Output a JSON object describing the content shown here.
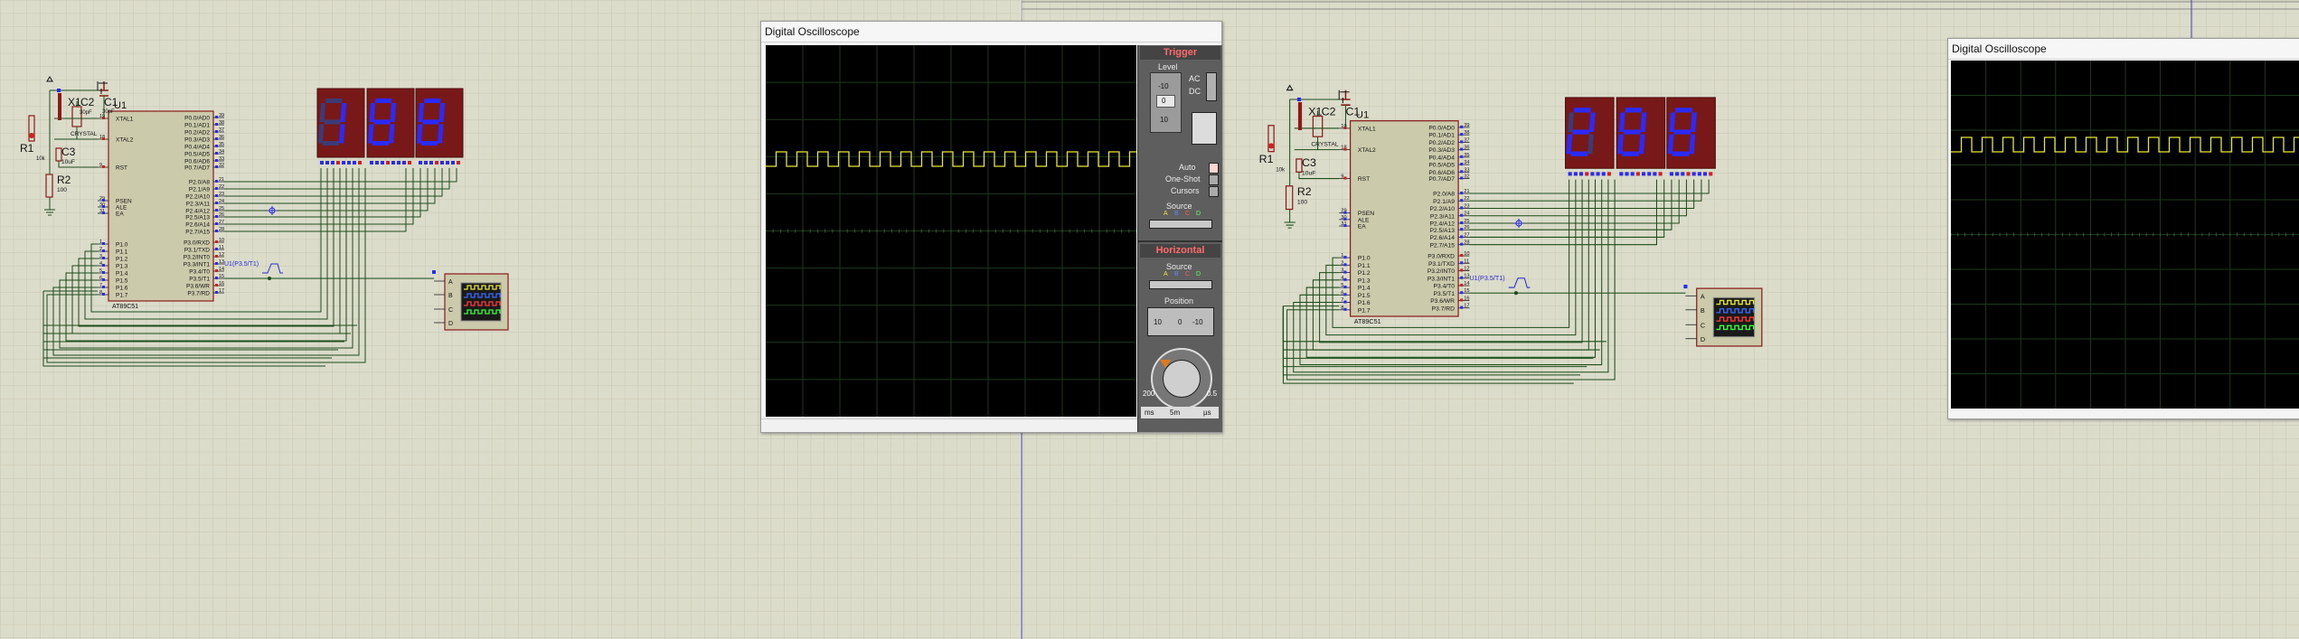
{
  "left_circuit": {
    "mcu_label": "U1",
    "mcu_part": "AT89C51",
    "left_pins": [
      {
        "num": "19",
        "name": "XTAL1"
      },
      {
        "num": "18",
        "name": "XTAL2"
      },
      {
        "num": "9",
        "name": "RST"
      },
      {
        "num": "29",
        "name": "PSEN"
      },
      {
        "num": "30",
        "name": "ALE"
      },
      {
        "num": "31",
        "name": "EA"
      },
      {
        "num": "1",
        "name": "P1.0"
      },
      {
        "num": "2",
        "name": "P1.1"
      },
      {
        "num": "3",
        "name": "P1.2"
      },
      {
        "num": "4",
        "name": "P1.3"
      },
      {
        "num": "5",
        "name": "P1.4"
      },
      {
        "num": "6",
        "name": "P1.5"
      },
      {
        "num": "7",
        "name": "P1.6"
      },
      {
        "num": "8",
        "name": "P1.7"
      }
    ],
    "right_pins": [
      {
        "num": "39",
        "name": "P0.0/AD0"
      },
      {
        "num": "38",
        "name": "P0.1/AD1"
      },
      {
        "num": "37",
        "name": "P0.2/AD2"
      },
      {
        "num": "36",
        "name": "P0.3/AD3"
      },
      {
        "num": "35",
        "name": "P0.4/AD4"
      },
      {
        "num": "34",
        "name": "P0.5/AD5"
      },
      {
        "num": "33",
        "name": "P0.6/AD6"
      },
      {
        "num": "32",
        "name": "P0.7/AD7"
      },
      {
        "num": "21",
        "name": "P2.0/A8"
      },
      {
        "num": "22",
        "name": "P2.1/A9"
      },
      {
        "num": "23",
        "name": "P2.2/A10"
      },
      {
        "num": "24",
        "name": "P2.3/A11"
      },
      {
        "num": "25",
        "name": "P2.4/A12"
      },
      {
        "num": "26",
        "name": "P2.5/A13"
      },
      {
        "num": "27",
        "name": "P2.6/A14"
      },
      {
        "num": "28",
        "name": "P2.7/A15"
      },
      {
        "num": "10",
        "name": "P3.0/RXD"
      },
      {
        "num": "11",
        "name": "P3.1/TXD"
      },
      {
        "num": "12",
        "name": "P3.2/INT0"
      },
      {
        "num": "13",
        "name": "P3.3/INT1"
      },
      {
        "num": "14",
        "name": "P3.4/T0"
      },
      {
        "num": "15",
        "name": "P3.5/T1"
      },
      {
        "num": "16",
        "name": "P3.6/WR"
      },
      {
        "num": "17",
        "name": "P3.7/RD"
      }
    ],
    "x1_label": "X1",
    "x1_part": "CRYSTAL",
    "c1_label": "C1",
    "c1_value": "30pF",
    "c2_label": "C2",
    "c2_value": "30pF",
    "c3_label": "C3",
    "c3_value": "10uF",
    "r1_label": "R1",
    "r1_value": "10k",
    "r2_label": "R2",
    "r2_value": "100",
    "probe_label": "U1(P3.5/T1)",
    "display_digits": [
      "1",
      "8",
      "8"
    ],
    "scope_channels": [
      "A",
      "B",
      "C",
      "D"
    ]
  },
  "right_circuit": {
    "mcu_label": "U1",
    "mcu_part": "AT89C51",
    "x1_label": "X1",
    "x1_part": "CRYSTAL",
    "c1_label": "C1",
    "c2_label": "C2",
    "c3_label": "C3",
    "c3_value": "10uF",
    "r1_label": "R1",
    "r1_value": "10k",
    "r2_label": "R2",
    "r2_value": "100",
    "probe_label": "U1(P3.5/T1)",
    "display_digits": [
      "2",
      "8",
      "8"
    ],
    "scope_channels": [
      "A",
      "B",
      "C",
      "D"
    ]
  },
  "left_scope": {
    "title": "Digital Oscilloscope",
    "trigger_title": "Trigger",
    "level_label": "Level",
    "ac_label": "AC",
    "dc_label": "DC",
    "level_scale": [
      "-10",
      "0",
      "10"
    ],
    "auto_label": "Auto",
    "one_shot_label": "One-Shot",
    "cursors_label": "Cursors",
    "source_label": "Source",
    "source_channels": [
      "A",
      "B",
      "C",
      "D"
    ],
    "horizontal_title": "Horizontal",
    "h_source_label": "Source",
    "position_label": "Position",
    "position_scale": [
      "10",
      "0",
      "-10"
    ],
    "timebase_labels": [
      "ms",
      "5m",
      "µs"
    ],
    "timebase_small": [
      "200",
      "0.5"
    ]
  },
  "right_scope": {
    "title": "Digital Oscilloscope"
  },
  "colors": {
    "background": "#dcdccb",
    "wire": "#1b4d1b",
    "component_outline": "#8b1a1a",
    "mcu_fill": "#cbcbab",
    "segment_on": "#2a2aff",
    "segment_off": "#3b3b78",
    "display_bg": "#781818",
    "trace": "#e6e63a",
    "scope_bg": "#000000",
    "grid": "#1d3a1d"
  }
}
